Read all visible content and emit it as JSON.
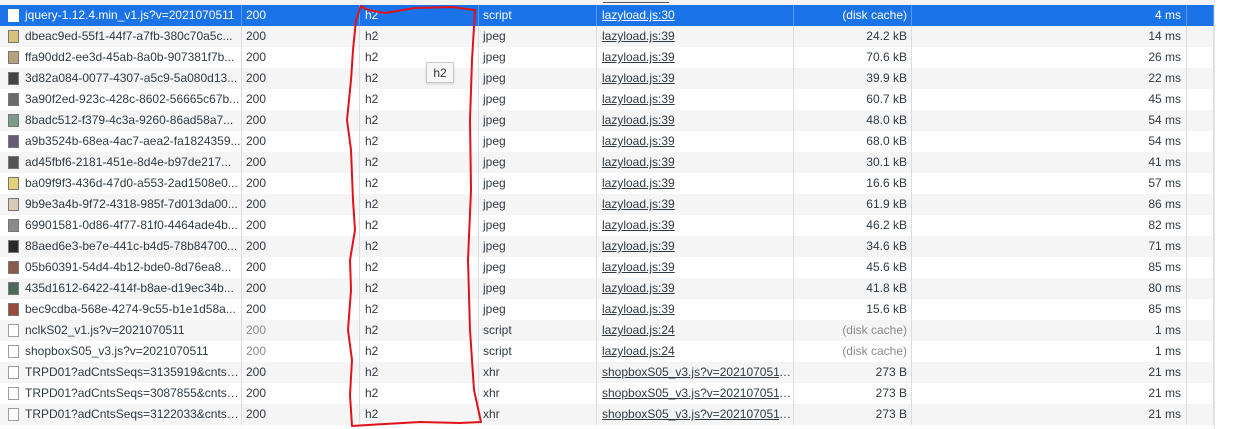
{
  "tooltip": "h2",
  "rows": [
    {
      "name": "jquery-1.12.4.min_v1.js?v=2021070511",
      "status": "200",
      "protocol": "h2",
      "type": "script",
      "initiator": "lazyload.js:30",
      "size": "(disk cache)",
      "time": "4 ms",
      "icon": "script-file-icon",
      "dim": false
    },
    {
      "name": "dbeac9ed-55f1-44f7-a7fb-380c70a5c...",
      "status": "200",
      "protocol": "h2",
      "type": "jpeg",
      "initiator": "lazyload.js:39",
      "size": "24.2 kB",
      "time": "14 ms",
      "icon": "image-thumbnail-icon",
      "dim": false,
      "thumb": "#d8c27a"
    },
    {
      "name": "ffa90dd2-ee3d-45ab-8a0b-907381f7b...",
      "status": "200",
      "protocol": "h2",
      "type": "jpeg",
      "initiator": "lazyload.js:39",
      "size": "70.6 kB",
      "time": "26 ms",
      "icon": "image-thumbnail-icon",
      "dim": false,
      "thumb": "#b8a27a"
    },
    {
      "name": "3d82a084-0077-4307-a5c9-5a080d13...",
      "status": "200",
      "protocol": "h2",
      "type": "jpeg",
      "initiator": "lazyload.js:39",
      "size": "39.9 kB",
      "time": "22 ms",
      "icon": "image-thumbnail-icon",
      "dim": false,
      "thumb": "#444444"
    },
    {
      "name": "3a90f2ed-923c-428c-8602-56665c67b...",
      "status": "200",
      "protocol": "h2",
      "type": "jpeg",
      "initiator": "lazyload.js:39",
      "size": "60.7 kB",
      "time": "45 ms",
      "icon": "image-thumbnail-icon",
      "dim": false,
      "thumb": "#6b6b6b"
    },
    {
      "name": "8badc512-f379-4c3a-9260-86ad58a7...",
      "status": "200",
      "protocol": "h2",
      "type": "jpeg",
      "initiator": "lazyload.js:39",
      "size": "48.0 kB",
      "time": "54 ms",
      "icon": "image-thumbnail-icon",
      "dim": false,
      "thumb": "#7a9a8a"
    },
    {
      "name": "a9b3524b-68ea-4ac7-aea2-fa1824359...",
      "status": "200",
      "protocol": "h2",
      "type": "jpeg",
      "initiator": "lazyload.js:39",
      "size": "68.0 kB",
      "time": "54 ms",
      "icon": "image-thumbnail-icon",
      "dim": false,
      "thumb": "#6a5a7a"
    },
    {
      "name": "ad45fbf6-2181-451e-8d4e-b97de217...",
      "status": "200",
      "protocol": "h2",
      "type": "jpeg",
      "initiator": "lazyload.js:39",
      "size": "30.1 kB",
      "time": "41 ms",
      "icon": "image-thumbnail-icon",
      "dim": false,
      "thumb": "#555555"
    },
    {
      "name": "ba09f9f3-436d-47d0-a553-2ad1508e0...",
      "status": "200",
      "protocol": "h2",
      "type": "jpeg",
      "initiator": "lazyload.js:39",
      "size": "16.6 kB",
      "time": "57 ms",
      "icon": "image-thumbnail-icon",
      "dim": false,
      "thumb": "#e4d27a"
    },
    {
      "name": "9b9e3a4b-9f72-4318-985f-7d013da00...",
      "status": "200",
      "protocol": "h2",
      "type": "jpeg",
      "initiator": "lazyload.js:39",
      "size": "61.9 kB",
      "time": "86 ms",
      "icon": "image-thumbnail-icon",
      "dim": false,
      "thumb": "#d9cbb5"
    },
    {
      "name": "69901581-0d86-4f77-81f0-4464ade4b...",
      "status": "200",
      "protocol": "h2",
      "type": "jpeg",
      "initiator": "lazyload.js:39",
      "size": "46.2 kB",
      "time": "82 ms",
      "icon": "image-thumbnail-icon",
      "dim": false,
      "thumb": "#8a8a8a"
    },
    {
      "name": "88aed6e3-be7e-441c-b4d5-78b84700...",
      "status": "200",
      "protocol": "h2",
      "type": "jpeg",
      "initiator": "lazyload.js:39",
      "size": "34.6 kB",
      "time": "71 ms",
      "icon": "image-thumbnail-icon",
      "dim": false,
      "thumb": "#2a2a2a"
    },
    {
      "name": "05b60391-54d4-4b12-bde0-8d76ea8...",
      "status": "200",
      "protocol": "h2",
      "type": "jpeg",
      "initiator": "lazyload.js:39",
      "size": "45.6 kB",
      "time": "85 ms",
      "icon": "image-thumbnail-icon",
      "dim": false,
      "thumb": "#8a5a4a"
    },
    {
      "name": "435d1612-6422-414f-b8ae-d19ec34b...",
      "status": "200",
      "protocol": "h2",
      "type": "jpeg",
      "initiator": "lazyload.js:39",
      "size": "41.8 kB",
      "time": "80 ms",
      "icon": "image-thumbnail-icon",
      "dim": false,
      "thumb": "#4a6a5a"
    },
    {
      "name": "bec9cdba-568e-4274-9c55-b1e1d58a...",
      "status": "200",
      "protocol": "h2",
      "type": "jpeg",
      "initiator": "lazyload.js:39",
      "size": "15.6 kB",
      "time": "85 ms",
      "icon": "image-thumbnail-icon",
      "dim": false,
      "thumb": "#9a4a3a"
    },
    {
      "name": "nclkS02_v1.js?v=2021070511",
      "status": "200",
      "protocol": "h2",
      "type": "script",
      "initiator": "lazyload.js:24",
      "size": "(disk cache)",
      "time": "1 ms",
      "icon": "script-file-icon",
      "dim": true
    },
    {
      "name": "shopboxS05_v3.js?v=2021070511",
      "status": "200",
      "protocol": "h2",
      "type": "script",
      "initiator": "lazyload.js:24",
      "size": "(disk cache)",
      "time": "1 ms",
      "icon": "script-file-icon",
      "dim": true
    },
    {
      "name": "TRPD01?adCntsSeqs=3135919&cntsT...",
      "status": "200",
      "protocol": "h2",
      "type": "xhr",
      "initiator": "shopboxS05_v3.js?v=2021070511...",
      "size": "273 B",
      "time": "21 ms",
      "icon": "xhr-file-icon",
      "dim": false
    },
    {
      "name": "TRPD01?adCntsSeqs=3087855&cntsT...",
      "status": "200",
      "protocol": "h2",
      "type": "xhr",
      "initiator": "shopboxS05_v3.js?v=2021070511...",
      "size": "273 B",
      "time": "21 ms",
      "icon": "xhr-file-icon",
      "dim": false
    },
    {
      "name": "TRPD01?adCntsSeqs=3122033&cntsT...",
      "status": "200",
      "protocol": "h2",
      "type": "xhr",
      "initiator": "shopboxS05_v3.js?v=2021070511...",
      "size": "273 B",
      "time": "21 ms",
      "icon": "xhr-file-icon",
      "dim": false
    }
  ]
}
